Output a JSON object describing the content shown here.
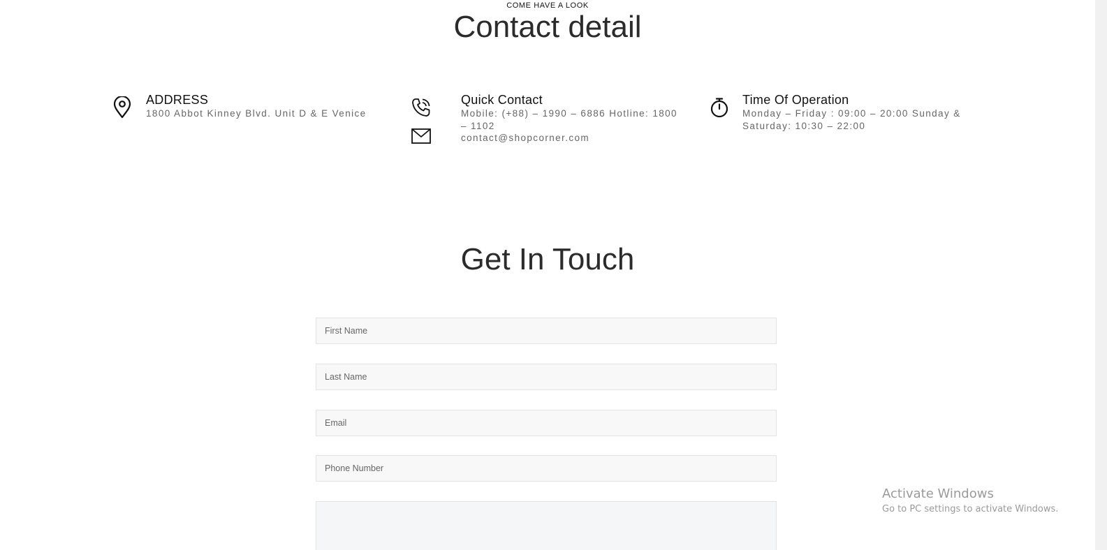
{
  "contact_section": {
    "eyebrow": "COME HAVE A LOOK",
    "title": "Contact detail",
    "address": {
      "icon": "map-pin-icon",
      "heading": "ADDRESS",
      "text": "1800 Abbot Kinney Blvd. Unit D & E Venice"
    },
    "quick_contact": {
      "icon": "phone-icon",
      "mail_icon": "mail-icon",
      "heading": "Quick Contact",
      "phones": "Mobile: (+88) – 1990 – 6886 Hotline: 1800 – 1102",
      "email": "contact@shopcorner.com"
    },
    "hours": {
      "icon": "stopwatch-icon",
      "heading": "Time Of Operation",
      "text": "Monday – Friday : 09:00 – 20:00 Sunday & Saturday: 10:30 – 22:00"
    }
  },
  "touch_section": {
    "title": "Get In Touch",
    "fields": {
      "first_name": {
        "placeholder": "First Name",
        "value": ""
      },
      "last_name": {
        "placeholder": "Last Name",
        "value": ""
      },
      "email": {
        "placeholder": "Email",
        "value": ""
      },
      "phone": {
        "placeholder": "Phone Number",
        "value": ""
      },
      "message": {
        "placeholder": "",
        "value": ""
      }
    }
  },
  "watermark": {
    "title": "Activate Windows",
    "subtitle": "Go to PC settings to activate Windows."
  }
}
